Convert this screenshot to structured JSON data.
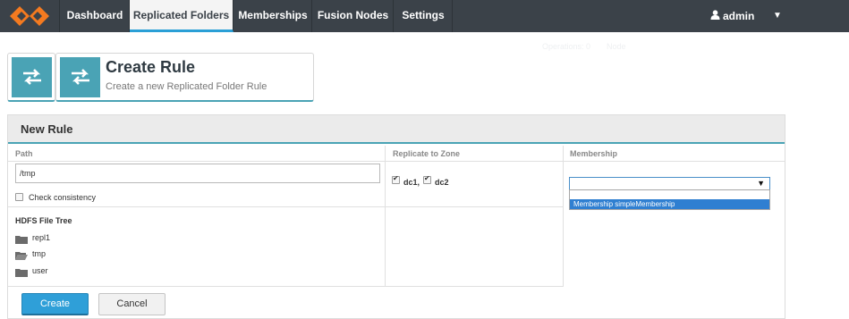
{
  "nav": {
    "tabs": [
      {
        "label": "Dashboard"
      },
      {
        "label": "Replicated Folders"
      },
      {
        "label": "Memberships"
      },
      {
        "label": "Fusion Nodes"
      },
      {
        "label": "Settings"
      }
    ],
    "active_tab": "Replicated Folders",
    "user": "admin"
  },
  "status": {
    "operations": "Operations: 0",
    "node": "Node"
  },
  "header": {
    "title": "Create Rule",
    "subtitle": "Create a new Replicated Folder Rule"
  },
  "panel": {
    "title": "New Rule",
    "columns": [
      "Path",
      "Replicate to Zone",
      "Membership"
    ]
  },
  "path": {
    "value": "/tmp",
    "check_consistency_label": "Check consistency",
    "check_consistency_checked": false
  },
  "zones": [
    {
      "label": "dc1,",
      "checked": true
    },
    {
      "label": "dc2",
      "checked": true
    }
  ],
  "tree": {
    "label": "HDFS File Tree",
    "items": [
      {
        "name": "repl1",
        "icon": "folder-closed-icon"
      },
      {
        "name": "tmp",
        "icon": "folder-open-icon"
      },
      {
        "name": "user",
        "icon": "folder-closed-icon"
      }
    ]
  },
  "membership": {
    "selected": "",
    "options": [
      "Membership simpleMembership"
    ]
  },
  "buttons": {
    "create": "Create",
    "cancel": "Cancel"
  },
  "colors": {
    "nav_bg": "#3b4249",
    "accent_teal": "#4aa3b5",
    "primary_blue": "#2f9fd8",
    "logo_orange": "#f47a20"
  }
}
